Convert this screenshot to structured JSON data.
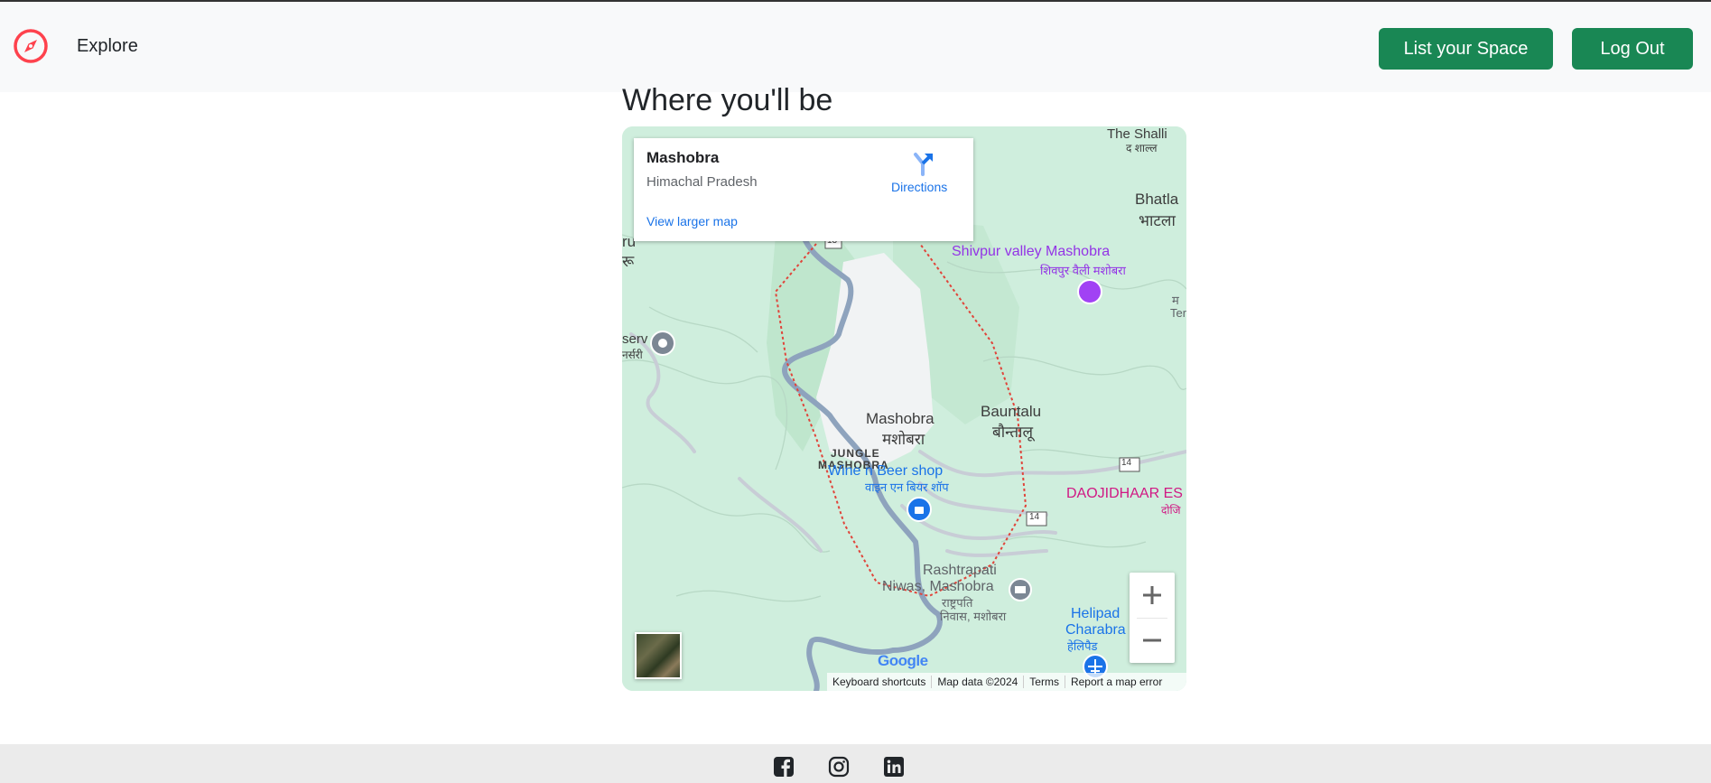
{
  "navbar": {
    "explore_label": "Explore",
    "list_space_label": "List your Space",
    "logout_label": "Log Out",
    "logo_icon": "compass-icon",
    "brand_color": "#fe424d",
    "button_color": "#198754"
  },
  "section": {
    "title": "Where you'll be"
  },
  "map": {
    "info_card": {
      "place_name": "Mashobra",
      "region": "Himachal Pradesh",
      "directions_label": "Directions",
      "larger_map_label": "View larger map"
    },
    "labels": {
      "mashobra_en": "Mashobra",
      "mashobra_hi": "मशोबरा",
      "bauntalu_en": "Bauntalu",
      "bauntalu_hi": "बौन्तालू",
      "shivpur_en": "Shivpur valley Mashobra",
      "shivpur_hi": "शिवपुर वैली मशोबरा",
      "bhatla_en": "Bhatla",
      "bhatla_hi": "भाटला",
      "shalli": "The Shalli",
      "shalli_hi": "द शाल्ल",
      "jungle_mashobra_1": "JUNGLE",
      "jungle_mashobra_2": "MASHOBRA",
      "wine_shop_en": "Wine n Beer shop",
      "wine_shop_hi": "वाइन एन बियर शॉप",
      "daojidhaar": "DAOJIDHAAR ES",
      "daojidhaar_hi": "दोजि",
      "rashtrapati_1": "Rashtrapati",
      "rashtrapati_2": "Niwas, Mashobra",
      "rashtrapati_hi_1": "राष्ट्रपति",
      "rashtrapati_hi_2": "निवास, मशोबरा",
      "helipad_1": "Helipad",
      "helipad_2": "Charabra",
      "helipad_hi": "हेलिपैड",
      "nursery_1": "serv",
      "nursery_2": "नर्सरी",
      "left_edge_1": "ru",
      "left_edge_2": "रू",
      "right_edge_1": "म",
      "right_edge_2": "Ter",
      "road_14a": "14",
      "road_14b": "14",
      "road_13": "13"
    },
    "attribution": {
      "shortcuts": "Keyboard shortcuts",
      "map_data": "Map data ©2024",
      "terms": "Terms",
      "report": "Report a map error"
    },
    "google_logo": "Google"
  },
  "footer": {
    "icons": [
      "facebook-icon",
      "instagram-icon",
      "linkedin-icon"
    ]
  }
}
